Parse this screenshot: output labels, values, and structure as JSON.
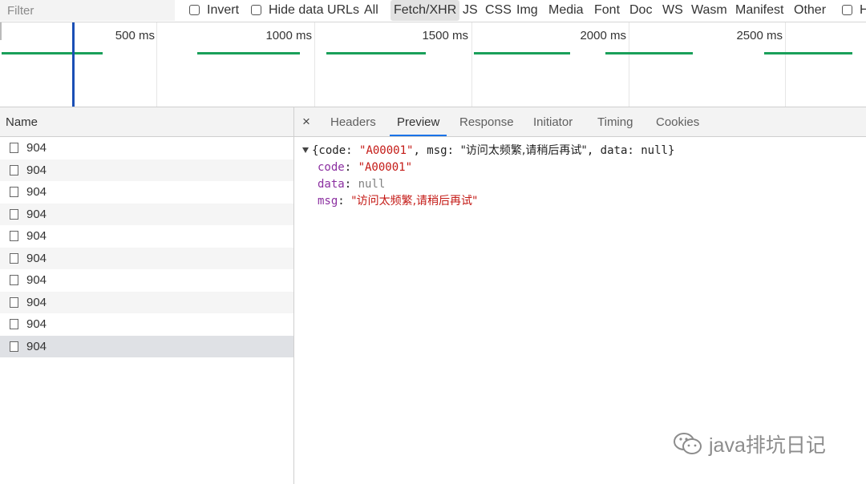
{
  "filterbar": {
    "placeholder": "Filter",
    "invert_label": "Invert",
    "hide_data_urls_label": "Hide data URLs",
    "types": [
      "All",
      "Fetch/XHR",
      "JS",
      "CSS",
      "Img",
      "Media",
      "Font",
      "Doc",
      "WS",
      "Wasm",
      "Manifest",
      "Other"
    ],
    "active_type": "Fetch/XHR",
    "trailing_label": "H"
  },
  "timeline": {
    "ticks": [
      "500 ms",
      "1000 ms",
      "1500 ms",
      "2000 ms",
      "2500 ms"
    ]
  },
  "name_panel": {
    "header": "Name",
    "rows": [
      "904",
      "904",
      "904",
      "904",
      "904",
      "904",
      "904",
      "904",
      "904",
      "904"
    ]
  },
  "detail": {
    "close_icon": "×",
    "tabs": [
      "Headers",
      "Preview",
      "Response",
      "Initiator",
      "Timing",
      "Cookies"
    ],
    "active_tab": "Preview",
    "preview": {
      "summary_open": "{code: ",
      "summary_code": "\"A00001\"",
      "summary_mid": ", msg: ",
      "summary_msg": "\"访问太频繁,请稍后再试\"",
      "summary_tail": ", data: null}",
      "lines": [
        {
          "key": "code",
          "value": "\"A00001\"",
          "kind": "str"
        },
        {
          "key": "data",
          "value": "null",
          "kind": "nul"
        },
        {
          "key": "msg",
          "value": "\"访问太频繁,请稍后再试\"",
          "kind": "str"
        }
      ]
    }
  },
  "watermark": {
    "text": "java排坑日记",
    "icon": "wechat-icon"
  },
  "colors": {
    "accent": "#1a73e8",
    "timeline_bar": "#1aa05a",
    "cursor": "#1a4fb5"
  }
}
